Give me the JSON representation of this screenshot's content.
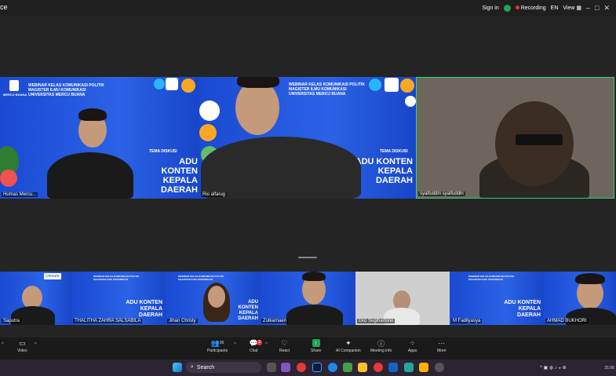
{
  "app": {
    "title": "ce"
  },
  "topbar": {
    "sign_in": "Sign in",
    "recording": "Recording",
    "lang": "EN",
    "view": "View",
    "window_buttons": [
      "–",
      "□",
      "✕"
    ]
  },
  "webinar_banner": {
    "line1": "WEBINAR KELAS KOMUNIKASI POLITIK",
    "line2": "MAGISTER ILMU KOMUNIKASI",
    "line3": "UNIVERSITAS MERCU BUANA",
    "logo_text": "MERCU BUANA",
    "tema": "TEMA DISKUSI",
    "title_line1": "ADU KONTEN",
    "title_line2": "KEPALA DAERAH"
  },
  "main_tiles": [
    {
      "name": "Humas Mercu..."
    },
    {
      "name": "Rio alfarug"
    },
    {
      "name": "syaifuddin syaifuddin"
    }
  ],
  "gallery": [
    {
      "name": "Saputra"
    },
    {
      "name": "THALITHA ZAHRA SALSABILA"
    },
    {
      "name": "Jihan Christy"
    },
    {
      "name": "Zulkarnaen"
    },
    {
      "name": "Eko Sugihartono"
    },
    {
      "name": "M Fadilyasya"
    },
    {
      "name": "AHMAD BUKHORI"
    }
  ],
  "unmute_label": "Unmute",
  "controls": {
    "video": "Video",
    "participants": "Participants",
    "participants_count": "96",
    "chat": "Chat",
    "chat_badge": "3",
    "react": "React",
    "share": "Share",
    "ai_companion": "AI Companion",
    "meeting_info": "Meeting info",
    "apps": "Apps",
    "more": "More"
  },
  "taskbar": {
    "search": "Search",
    "time": "21:06"
  },
  "colors": {
    "accent": "#23a455",
    "active_border": "#2ed57a",
    "banner": "#1b4fd0"
  }
}
